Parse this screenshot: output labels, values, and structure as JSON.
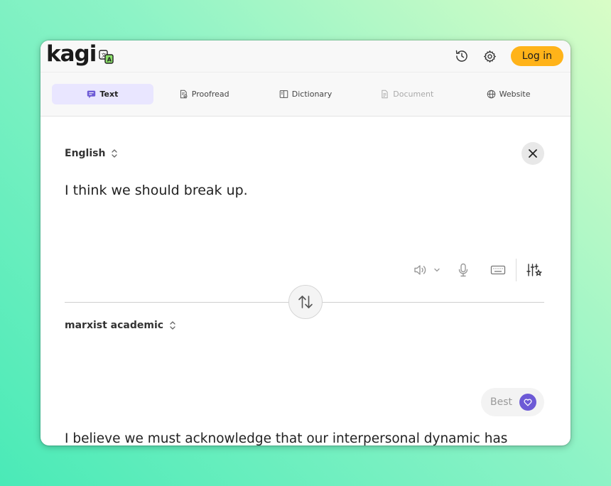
{
  "header": {
    "logo_text": "kagi",
    "login_label": "Log in"
  },
  "tabs": [
    {
      "label": "Text",
      "icon": "chat-bubble-icon",
      "state": "active"
    },
    {
      "label": "Proofread",
      "icon": "document-check-icon",
      "state": "normal"
    },
    {
      "label": "Dictionary",
      "icon": "book-icon",
      "state": "normal"
    },
    {
      "label": "Document",
      "icon": "document-icon",
      "state": "disabled"
    },
    {
      "label": "Website",
      "icon": "globe-icon",
      "state": "normal"
    }
  ],
  "source": {
    "language": "English",
    "text": "I think we should break up."
  },
  "target": {
    "style": "marxist academic",
    "quality_label": "Best",
    "text": "I believe we must acknowledge that our interpersonal dynamic has reached a point of irreconcilable structural contradiction, necessitating a formal dissolution of this union to cease the continued reproduction of our shared emotional alienation."
  },
  "colors": {
    "accent": "#6d5ad6",
    "active_tab_bg": "#e9e6ff",
    "login_bg": "#ffb319"
  }
}
